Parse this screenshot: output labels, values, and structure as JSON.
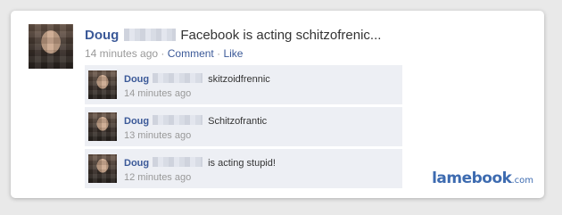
{
  "post": {
    "author": "Doug",
    "text": "Facebook is acting schitzofrenic...",
    "time": "14 minutes ago",
    "separator": "·",
    "comment_link": "Comment",
    "like_link": "Like"
  },
  "comments": [
    {
      "author": "Doug",
      "text": "skitzoidfrennic",
      "time": "14 minutes ago"
    },
    {
      "author": "Doug",
      "text": "Schitzofrantic",
      "time": "13 minutes ago"
    },
    {
      "author": "Doug",
      "text": "is acting stupid!",
      "time": "12 minutes ago"
    }
  ],
  "watermark": {
    "brand": "lamebook",
    "tld": ".com"
  },
  "colors": {
    "link": "#3b5998",
    "comment_bg": "#edeff4",
    "meta": "#999999"
  }
}
